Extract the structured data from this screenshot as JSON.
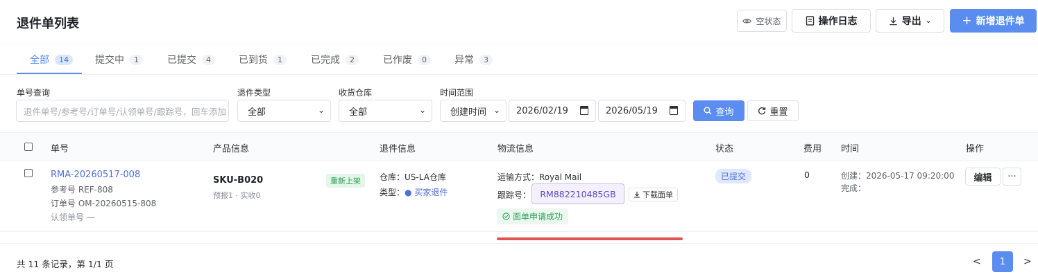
{
  "header": {
    "title": "退件单列表",
    "empty_state_label": "空状态",
    "log_label": "操作日志",
    "export_label": "导出",
    "new_label": "新增退件单"
  },
  "tabs": [
    {
      "label": "全部",
      "count": "14",
      "active": true
    },
    {
      "label": "提交中",
      "count": "1"
    },
    {
      "label": "已提交",
      "count": "4"
    },
    {
      "label": "已到货",
      "count": "1"
    },
    {
      "label": "已完成",
      "count": "2"
    },
    {
      "label": "已作废",
      "count": "0"
    },
    {
      "label": "异常",
      "count": "3"
    }
  ],
  "filters": {
    "order_label": "单号查询",
    "order_placeholder": "退件单号/参考号/订单号/认领单号/跟踪号，回车添加",
    "type_label": "退件类型",
    "type_value": "全部",
    "warehouse_label": "收货仓库",
    "warehouse_value": "全部",
    "time_label": "时间范围",
    "time_type_value": "创建时间",
    "date_start": "2026/02/19",
    "date_end": "2026/05/19",
    "query_label": "查询",
    "reset_label": "重置"
  },
  "table": {
    "headers": [
      "单号",
      "产品信息",
      "退件信息",
      "物流信息",
      "状态",
      "费用",
      "时间",
      "操作"
    ],
    "rows": [
      {
        "rma": "RMA-20260517-008",
        "ref": "参考号 REF-808",
        "order": "订单号 OM-20260515-808",
        "claim": "认领单号 —",
        "sku": "SKU-B020",
        "qty": "预报1 · 实收0",
        "sku_tag": "重新上架",
        "warehouse": "仓库：US-LA仓库",
        "type_prefix": "类型：",
        "type_value": "买家退件",
        "ship_method": "运输方式：Royal Mail",
        "track_label": "跟踪号：",
        "track_no": "RM882210485GB",
        "download_label": "下载面单",
        "label_status": "面单申请成功",
        "status": "已提交",
        "fee": "0",
        "created": "创建：2026-05-17 09:20:00",
        "finished": "完成：",
        "edit_label": "编辑",
        "more_label": "···"
      }
    ]
  },
  "footer": {
    "summary": "共 11 条记录，第 1/1 页",
    "prev": "<",
    "current_page": "1",
    "next": ">"
  },
  "colors": {
    "primary": "#5b8cf0",
    "success": "#2f9e59",
    "highlight_line": "#e05550"
  }
}
